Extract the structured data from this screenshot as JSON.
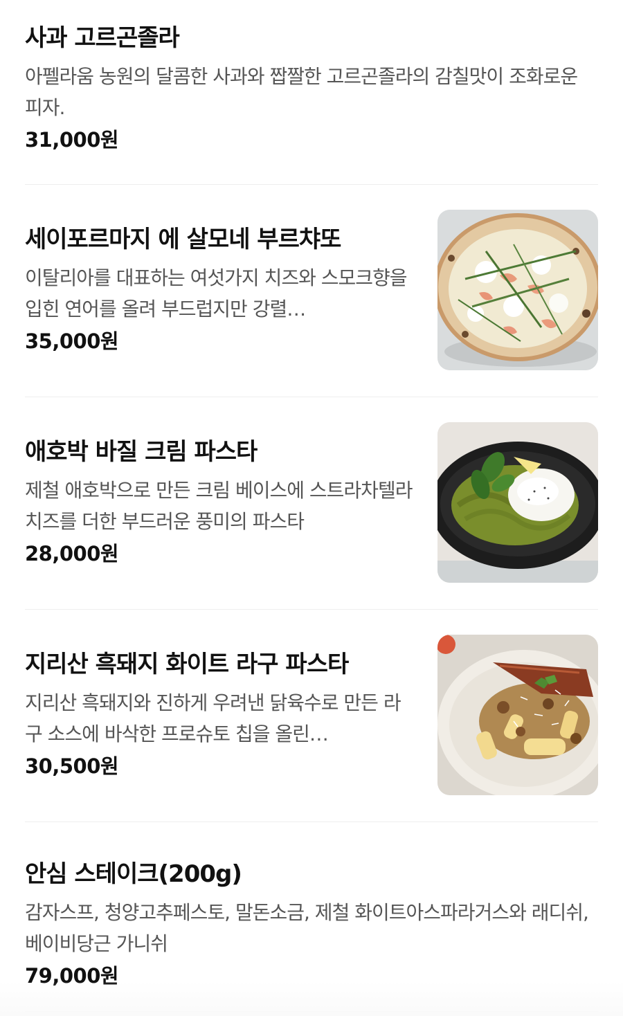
{
  "menu": {
    "items": [
      {
        "name": "사과 고르곤졸라",
        "description": "아펠라움 농원의 달콤한 사과와 짭짤한 고르곤졸라의 감칠맛이 조화로운 피자.",
        "price": "31,000원",
        "photo": null
      },
      {
        "name": "세이포르마지 에 살모네 부르챠또",
        "description": "이탈리아를 대표하는 여섯가지 치즈와 스모크향을 입힌 연어를 올려 부드럽지만 강렬…",
        "price": "35,000원",
        "photo": "salmon-pizza-photo"
      },
      {
        "name": "애호박 바질 크림 파스타",
        "description": "제철 애호박으로 만든 크림 베이스에 스트라차텔라 치즈를 더한 부드러운 풍미의 파스타",
        "price": "28,000원",
        "photo": "zucchini-pasta-photo"
      },
      {
        "name": "지리산 흑돼지 화이트 라구 파스타",
        "description": "지리산 흑돼지와 진하게 우려낸 닭육수로 만든 라구 소스에 바삭한 프로슈토 칩을 올린…",
        "price": "30,500원",
        "photo": "ragu-pasta-photo"
      },
      {
        "name": "안심 스테이크(200g)",
        "description": "감자스프, 청양고추페스토, 말돈소금, 제철 화이트아스파라거스와 래디쉬, 베이비당근 가니쉬",
        "price": "79,000원",
        "photo": null
      }
    ]
  }
}
